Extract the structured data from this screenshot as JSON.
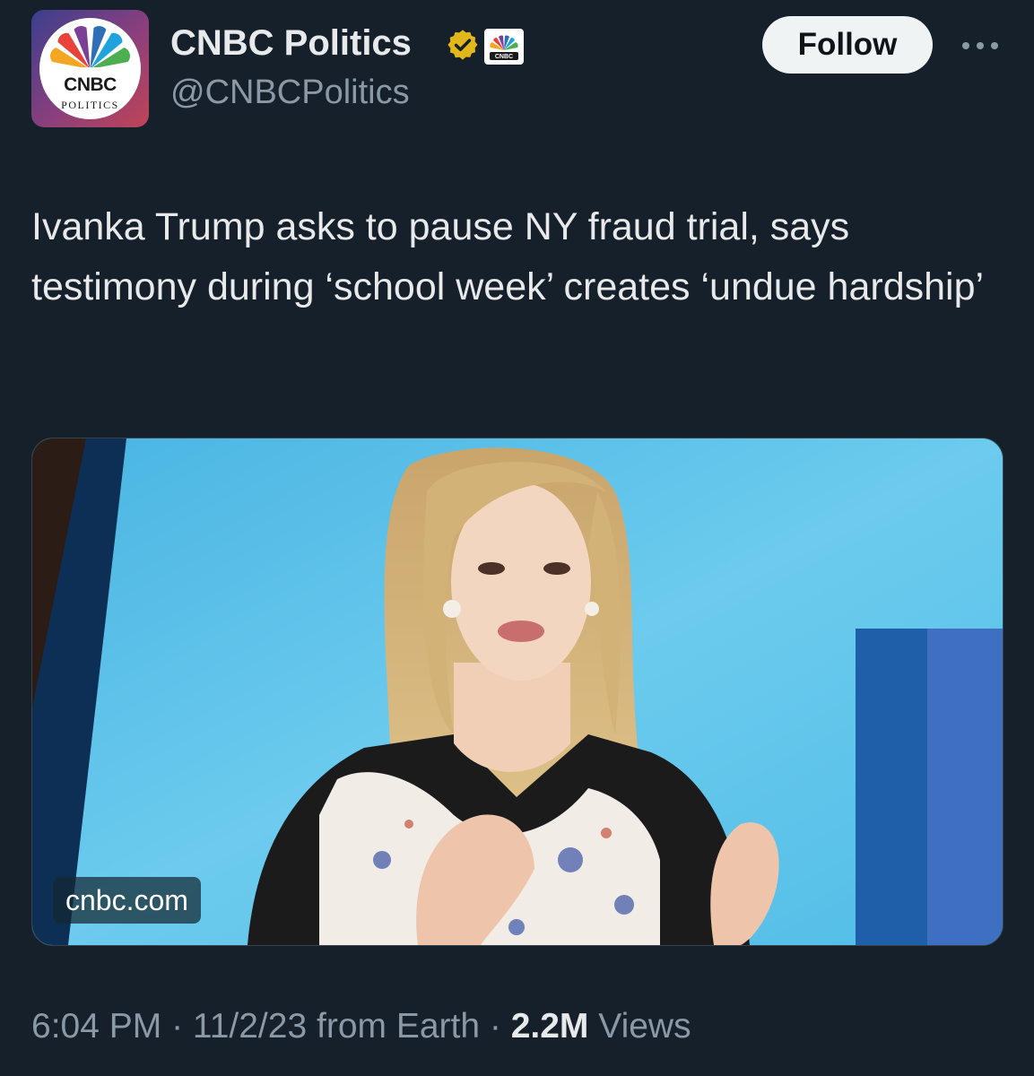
{
  "account": {
    "display_name": "CNBC Politics",
    "handle": "@CNBCPolitics",
    "avatar_brand": "CNBC",
    "avatar_sub": "POLITICS",
    "affiliate_badge": "CNBC",
    "verified_color": "#e2b719"
  },
  "actions": {
    "follow_label": "Follow",
    "more_icon": "ellipsis-icon"
  },
  "tweet": {
    "text": "Ivanka Trump asks to pause NY fraud trial, says testimony during ‘school week’ creates ‘undue hardship’"
  },
  "card": {
    "domain": "cnbc.com"
  },
  "meta": {
    "time": "6:04 PM",
    "separator": " · ",
    "date": "11/2/23",
    "source": " from Earth",
    "views_count": "2.2M",
    "views_label": " Views"
  },
  "colors": {
    "background": "#15202b",
    "text": "#e7e9ea",
    "secondary": "#8b98a5"
  }
}
